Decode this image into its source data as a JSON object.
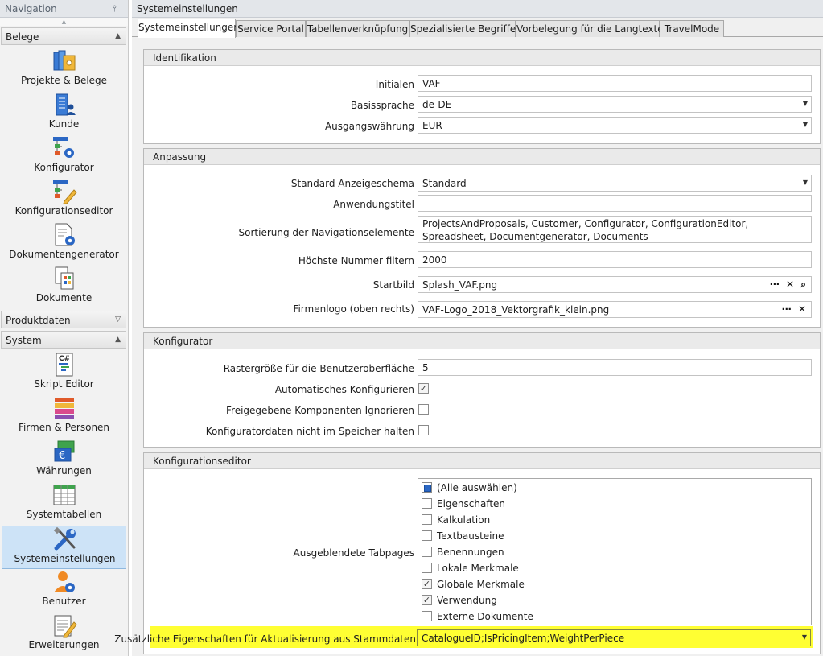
{
  "nav": {
    "title": "Navigation",
    "pin_glyph": "↕",
    "groups": {
      "belege": {
        "label": "Belege",
        "chevron": "▲"
      },
      "produktdaten": {
        "label": "Produktdaten",
        "chevron": "▽"
      },
      "system": {
        "label": "System",
        "chevron": "▲"
      }
    },
    "items": {
      "projekte": "Projekte & Belege",
      "kunde": "Kunde",
      "konfigurator": "Konfigurator",
      "konfigurationseditor": "Konfigurationseditor",
      "dokumentengenerator": "Dokumentengenerator",
      "dokumente": "Dokumente",
      "skript": "Skript Editor",
      "firmen": "Firmen & Personen",
      "waehrungen": "Währungen",
      "systemtabellen": "Systemtabellen",
      "systemeinstellungen": "Systemeinstellungen",
      "benutzer": "Benutzer",
      "erweiterungen": "Erweiterungen"
    },
    "selected": "systemeinstellungen"
  },
  "main": {
    "title": "Systemeinstellungen",
    "tabs": [
      "Systemeinstellungen",
      "Service Portal",
      "Tabellenverknüpfung",
      "Spezialisierte Begriffe",
      "Vorbelegung für die Langtexte",
      "TravelMode"
    ],
    "active_tab": 0
  },
  "identifikation": {
    "title": "Identifikation",
    "initialen_label": "Initialen",
    "initialen_value": "VAF",
    "basissprache_label": "Basissprache",
    "basissprache_value": "de-DE",
    "ausgangswaehrung_label": "Ausgangswährung",
    "ausgangswaehrung_value": "EUR"
  },
  "anpassung": {
    "title": "Anpassung",
    "anzeigeschema_label": "Standard Anzeigeschema",
    "anzeigeschema_value": "Standard",
    "anwendungstitel_label": "Anwendungstitel",
    "anwendungstitel_value": "",
    "sortierung_label": "Sortierung der Navigationselemente",
    "sortierung_value": "ProjectsAndProposals, Customer, Configurator, ConfigurationEditor, Spreadsheet, Documentgenerator, Documents",
    "hoechste_label": "Höchste Nummer filtern",
    "hoechste_value": "2000",
    "startbild_label": "Startbild",
    "startbild_value": "Splash_VAF.png",
    "firmenlogo_label": "Firmenlogo (oben rechts)",
    "firmenlogo_value": "VAF-Logo_2018_Vektorgrafik_klein.png"
  },
  "konfigurator": {
    "title": "Konfigurator",
    "raster_label": "Rastergröße für die Benutzeroberfläche",
    "raster_value": "5",
    "auto_label": "Automatisches Konfigurieren",
    "auto_checked": true,
    "freigegeben_label": "Freigegebene Komponenten Ignorieren",
    "freigegeben_checked": false,
    "speicher_label": "Konfiguratordaten nicht im Speicher halten",
    "speicher_checked": false
  },
  "konfigurationseditor": {
    "title": "Konfigurationseditor",
    "tabpages_label": "Ausgeblendete Tabpages",
    "tabpages": [
      {
        "label": "(Alle auswählen)",
        "state": "partial"
      },
      {
        "label": "Eigenschaften",
        "state": "unchecked"
      },
      {
        "label": "Kalkulation",
        "state": "unchecked"
      },
      {
        "label": "Textbausteine",
        "state": "unchecked"
      },
      {
        "label": "Benennungen",
        "state": "unchecked"
      },
      {
        "label": "Lokale Merkmale",
        "state": "unchecked"
      },
      {
        "label": "Globale Merkmale",
        "state": "checked"
      },
      {
        "label": "Verwendung",
        "state": "checked"
      },
      {
        "label": "Externe Dokumente",
        "state": "unchecked"
      }
    ],
    "zusatz_label": "Zusätzliche Eigenschaften für Aktualisierung aus Stammdaten",
    "zusatz_value": "CatalogueID;IsPricingItem;WeightPerPiece"
  },
  "glyphs": {
    "dropdown": "▼",
    "ellipsis_clear": "⋯ ✕",
    "ellipsis_clear_search": "⋯ ✕ ⌕",
    "checkmark": "✓",
    "scroll_up": "▲"
  },
  "colors": {
    "highlight": "#ffff33",
    "selected_nav": "#cde3f7",
    "accent_blue": "#2b67c4"
  }
}
